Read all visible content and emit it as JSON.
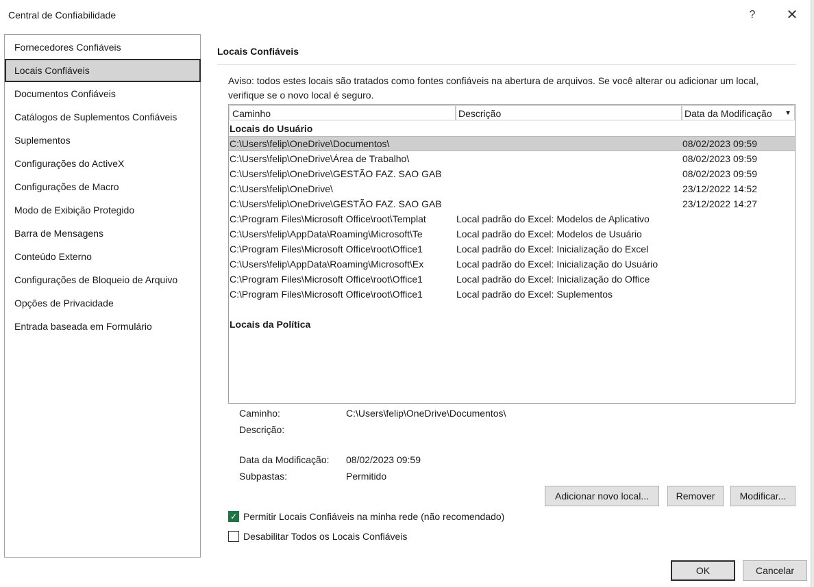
{
  "dialog": {
    "title": "Central de Confiabilidade",
    "help_label": "?",
    "close_label": "✕"
  },
  "sidebar": {
    "items": [
      {
        "label": "Fornecedores Confiáveis"
      },
      {
        "label": "Locais Confiáveis"
      },
      {
        "label": "Documentos Confiáveis"
      },
      {
        "label": "Catálogos de Suplementos Confiáveis"
      },
      {
        "label": "Suplementos"
      },
      {
        "label": "Configurações do ActiveX"
      },
      {
        "label": "Configurações de Macro"
      },
      {
        "label": "Modo de Exibição Protegido"
      },
      {
        "label": "Barra de Mensagens"
      },
      {
        "label": "Conteúdo Externo"
      },
      {
        "label": "Configurações de Bloqueio de Arquivo"
      },
      {
        "label": "Opções de Privacidade"
      },
      {
        "label": "Entrada baseada em Formulário"
      }
    ],
    "selected": "Locais Confiáveis"
  },
  "main": {
    "section_title": "Locais Confiáveis",
    "notice_line1": "Aviso: todos estes locais são tratados como fontes confiáveis na abertura de arquivos.  Se você alterar ou adicionar um local,",
    "notice_line2": "verifique se o novo local é seguro.",
    "columns": {
      "path": "Caminho",
      "description": "Descrição",
      "modified": "Data da Modificação",
      "sort_icon": "▼"
    },
    "user_group_label": "Locais do Usuário",
    "rows": [
      {
        "path": "C:\\Users\\felip\\OneDrive\\Documentos\\",
        "desc": "",
        "date": "08/02/2023 09:59"
      },
      {
        "path": "C:\\Users\\felip\\OneDrive\\Área de Trabalho\\",
        "desc": "",
        "date": "08/02/2023 09:59"
      },
      {
        "path": "C:\\Users\\felip\\OneDrive\\GESTÃO FAZ. SAO GAB",
        "desc": "",
        "date": "08/02/2023 09:59"
      },
      {
        "path": "C:\\Users\\felip\\OneDrive\\",
        "desc": "",
        "date": "23/12/2022 14:52"
      },
      {
        "path": "C:\\Users\\felip\\OneDrive\\GESTÃO FAZ. SAO GAB",
        "desc": "",
        "date": "23/12/2022 14:27"
      },
      {
        "path": "C:\\Program Files\\Microsoft Office\\root\\Templat",
        "desc": "Local padrão do Excel: Modelos de Aplicativo",
        "date": ""
      },
      {
        "path": "C:\\Users\\felip\\AppData\\Roaming\\Microsoft\\Te",
        "desc": "Local padrão do Excel: Modelos de Usuário",
        "date": ""
      },
      {
        "path": "C:\\Program Files\\Microsoft Office\\root\\Office1",
        "desc": "Local padrão do Excel: Inicialização do Excel",
        "date": ""
      },
      {
        "path": "C:\\Users\\felip\\AppData\\Roaming\\Microsoft\\Ex",
        "desc": "Local padrão do Excel: Inicialização do Usuário",
        "date": ""
      },
      {
        "path": "C:\\Program Files\\Microsoft Office\\root\\Office1",
        "desc": "Local padrão do Excel: Inicialização do Office",
        "date": ""
      },
      {
        "path": "C:\\Program Files\\Microsoft Office\\root\\Office1",
        "desc": "Local padrão do Excel: Suplementos",
        "date": ""
      }
    ],
    "policy_group_label": "Locais da Política",
    "details": {
      "path_label": "Caminho:",
      "path_value": "C:\\Users\\felip\\OneDrive\\Documentos\\",
      "desc_label": "Descrição:",
      "desc_value": "",
      "modified_label": "Data da Modificação:",
      "modified_value": "08/02/2023 09:59",
      "subfolders_label": "Subpastas:",
      "subfolders_value": "Permitido"
    },
    "buttons": {
      "add": "Adicionar novo local...",
      "remove": "Remover",
      "modify": "Modificar..."
    },
    "checkboxes": {
      "allow_network": {
        "label": "Permitir Locais Confiáveis na minha rede (não recomendado)",
        "checked": true
      },
      "disable_all": {
        "label": "Desabilitar Todos os Locais Confiáveis",
        "checked": false
      }
    }
  },
  "footer": {
    "ok": "OK",
    "cancel": "Cancelar"
  },
  "colors": {
    "accent_checkbox": "#217346",
    "selection": "#cfcfcf"
  }
}
